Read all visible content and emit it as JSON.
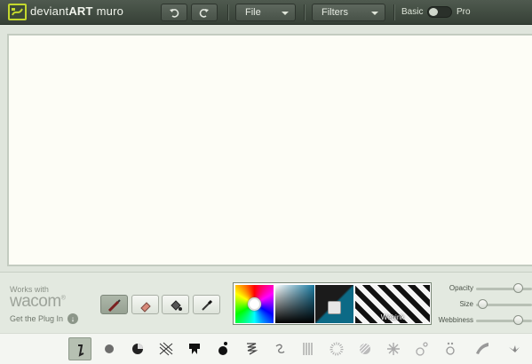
{
  "app": {
    "name_light": "deviant",
    "name_bold": "ART",
    "name_suffix": "muro"
  },
  "toolbar": {
    "undo_icon": "undo-icon",
    "redo_icon": "redo-icon",
    "file_label": "File",
    "filters_label": "Filters",
    "mode_basic": "Basic",
    "mode_pro": "Pro",
    "mode_selected": "Basic"
  },
  "wacom": {
    "works_with": "Works with",
    "logo_text": "wacom",
    "plugin_label": "Get the Plug In"
  },
  "tools": [
    {
      "name": "brush-tool",
      "icon": "brush-icon",
      "active": true
    },
    {
      "name": "eraser-tool",
      "icon": "eraser-icon",
      "active": false
    },
    {
      "name": "fill-tool",
      "icon": "bucket-icon",
      "active": false
    },
    {
      "name": "color-picker-tool",
      "icon": "eyedropper-icon",
      "active": false
    }
  ],
  "color": {
    "current": "#0c6a86",
    "secondary": "#1b1b1b",
    "webink_label": "Webink"
  },
  "sliders": {
    "opacity_label": "Opacity",
    "size_label": "Size",
    "webbiness_label": "Webbiness",
    "opacity_level": 0.75,
    "size_level": 0.1,
    "webbiness_level": 0.75
  },
  "brushes": [
    "pen-brush",
    "soft-dot-brush",
    "pie-brush",
    "hatch-brush",
    "drip-brush",
    "splatter-brush",
    "spiral-brush",
    "swirl-brush",
    "lines-brush",
    "dots-brush",
    "diagonal-brush",
    "burst-brush",
    "bubble-brush",
    "ring-brush",
    "feather-brush",
    "leaf-brush"
  ],
  "colors": {
    "topbar": "#3f493f",
    "accent": "#c4d82e",
    "canvas": "#fdfdf6"
  }
}
